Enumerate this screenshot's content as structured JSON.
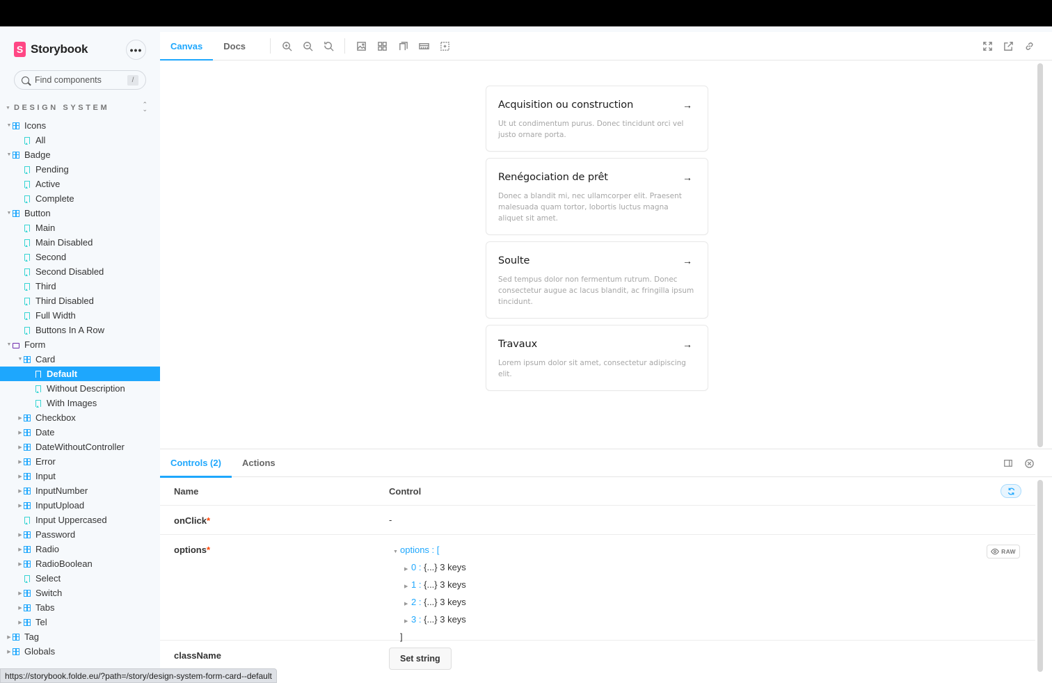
{
  "brand": {
    "logo_letter": "S",
    "name": "Storybook",
    "menu_label": "•••"
  },
  "search": {
    "placeholder": "Find components",
    "shortcut": "/"
  },
  "sidebar": {
    "section_title": "DESIGN SYSTEM",
    "tree": [
      {
        "label": "Icons",
        "type": "component",
        "depth": 0,
        "arrow": "open"
      },
      {
        "label": "All",
        "type": "story",
        "depth": 1
      },
      {
        "label": "Badge",
        "type": "component",
        "depth": 0,
        "arrow": "open"
      },
      {
        "label": "Pending",
        "type": "story",
        "depth": 1
      },
      {
        "label": "Active",
        "type": "story",
        "depth": 1
      },
      {
        "label": "Complete",
        "type": "story",
        "depth": 1
      },
      {
        "label": "Button",
        "type": "component",
        "depth": 0,
        "arrow": "open"
      },
      {
        "label": "Main",
        "type": "story",
        "depth": 1
      },
      {
        "label": "Main Disabled",
        "type": "story",
        "depth": 1
      },
      {
        "label": "Second",
        "type": "story",
        "depth": 1
      },
      {
        "label": "Second Disabled",
        "type": "story",
        "depth": 1
      },
      {
        "label": "Third",
        "type": "story",
        "depth": 1
      },
      {
        "label": "Third Disabled",
        "type": "story",
        "depth": 1
      },
      {
        "label": "Full Width",
        "type": "story",
        "depth": 1
      },
      {
        "label": "Buttons In A Row",
        "type": "story",
        "depth": 1
      },
      {
        "label": "Form",
        "type": "folder",
        "depth": 0,
        "arrow": "open"
      },
      {
        "label": "Card",
        "type": "component",
        "depth": 1,
        "arrow": "open"
      },
      {
        "label": "Default",
        "type": "story",
        "depth": 2,
        "selected": true
      },
      {
        "label": "Without Description",
        "type": "story",
        "depth": 2
      },
      {
        "label": "With Images",
        "type": "story",
        "depth": 2
      },
      {
        "label": "Checkbox",
        "type": "component",
        "depth": 1,
        "arrow": "closed"
      },
      {
        "label": "Date",
        "type": "component",
        "depth": 1,
        "arrow": "closed"
      },
      {
        "label": "DateWithoutController",
        "type": "component",
        "depth": 1,
        "arrow": "closed"
      },
      {
        "label": "Error",
        "type": "component",
        "depth": 1,
        "arrow": "closed"
      },
      {
        "label": "Input",
        "type": "component",
        "depth": 1,
        "arrow": "closed"
      },
      {
        "label": "InputNumber",
        "type": "component",
        "depth": 1,
        "arrow": "closed"
      },
      {
        "label": "InputUpload",
        "type": "component",
        "depth": 1,
        "arrow": "closed"
      },
      {
        "label": "Input Uppercased",
        "type": "story",
        "depth": 1
      },
      {
        "label": "Password",
        "type": "component",
        "depth": 1,
        "arrow": "closed"
      },
      {
        "label": "Radio",
        "type": "component",
        "depth": 1,
        "arrow": "closed"
      },
      {
        "label": "RadioBoolean",
        "type": "component",
        "depth": 1,
        "arrow": "closed"
      },
      {
        "label": "Select",
        "type": "story",
        "depth": 1
      },
      {
        "label": "Switch",
        "type": "component",
        "depth": 1,
        "arrow": "closed"
      },
      {
        "label": "Tabs",
        "type": "component",
        "depth": 1,
        "arrow": "closed"
      },
      {
        "label": "Tel",
        "type": "component",
        "depth": 1,
        "arrow": "closed"
      },
      {
        "label": "Tag",
        "type": "component",
        "depth": 0,
        "arrow": "closed"
      },
      {
        "label": "Globals",
        "type": "component",
        "depth": 0,
        "arrow": "closed"
      }
    ]
  },
  "toolbar": {
    "tabs": [
      "Canvas",
      "Docs"
    ],
    "icons": [
      "zoom-in-icon",
      "zoom-out-icon",
      "zoom-reset-icon",
      "background-icon",
      "grid-icon",
      "viewport-icon",
      "measure-icon",
      "outline-icon"
    ],
    "right_icons": [
      "fullscreen-icon",
      "open-new-tab-icon",
      "copy-link-icon"
    ]
  },
  "cards": [
    {
      "title": "Acquisition ou construction",
      "arrow": "→",
      "description": "Ut ut condimentum purus. Donec tincidunt orci vel justo ornare porta."
    },
    {
      "title": "Renégociation de prêt",
      "arrow": "→",
      "description": "Donec a blandit mi, nec ullamcorper elit. Praesent malesuada quam tortor, lobortis luctus magna aliquet sit amet."
    },
    {
      "title": "Soulte",
      "arrow": "→",
      "description": "Sed tempus dolor non fermentum rutrum. Donec consectetur augue ac lacus blandit, ac fringilla ipsum tincidunt."
    },
    {
      "title": "Travaux",
      "arrow": "→",
      "description": "Lorem ipsum dolor sit amet, consectetur adipiscing elit."
    }
  ],
  "addons": {
    "tabs": [
      "Controls (2)",
      "Actions"
    ],
    "header": {
      "name": "Name",
      "control": "Control"
    },
    "rows": {
      "onclick": {
        "name": "onClick",
        "required": "*",
        "value": "-"
      },
      "options": {
        "name": "options",
        "required": "*",
        "key": "options",
        "open_bracket": ":  [",
        "close_bracket": "]",
        "items": [
          {
            "index": "0",
            "sep": ":",
            "value": "{...} 3 keys"
          },
          {
            "index": "1",
            "sep": ":",
            "value": "{...} 3 keys"
          },
          {
            "index": "2",
            "sep": ":",
            "value": "{...} 3 keys"
          },
          {
            "index": "3",
            "sep": ":",
            "value": "{...} 3 keys"
          }
        ],
        "raw_label": "RAW"
      },
      "classname": {
        "name": "className",
        "button": "Set string"
      }
    }
  },
  "status_url": "https://storybook.folde.eu/?path=/story/design-system-form-card--default",
  "colors": {
    "accent": "#1ea7fd",
    "brand": "#ff4785",
    "story": "#37d5d3",
    "folder": "#6f2cac",
    "required": "#ff4400"
  }
}
